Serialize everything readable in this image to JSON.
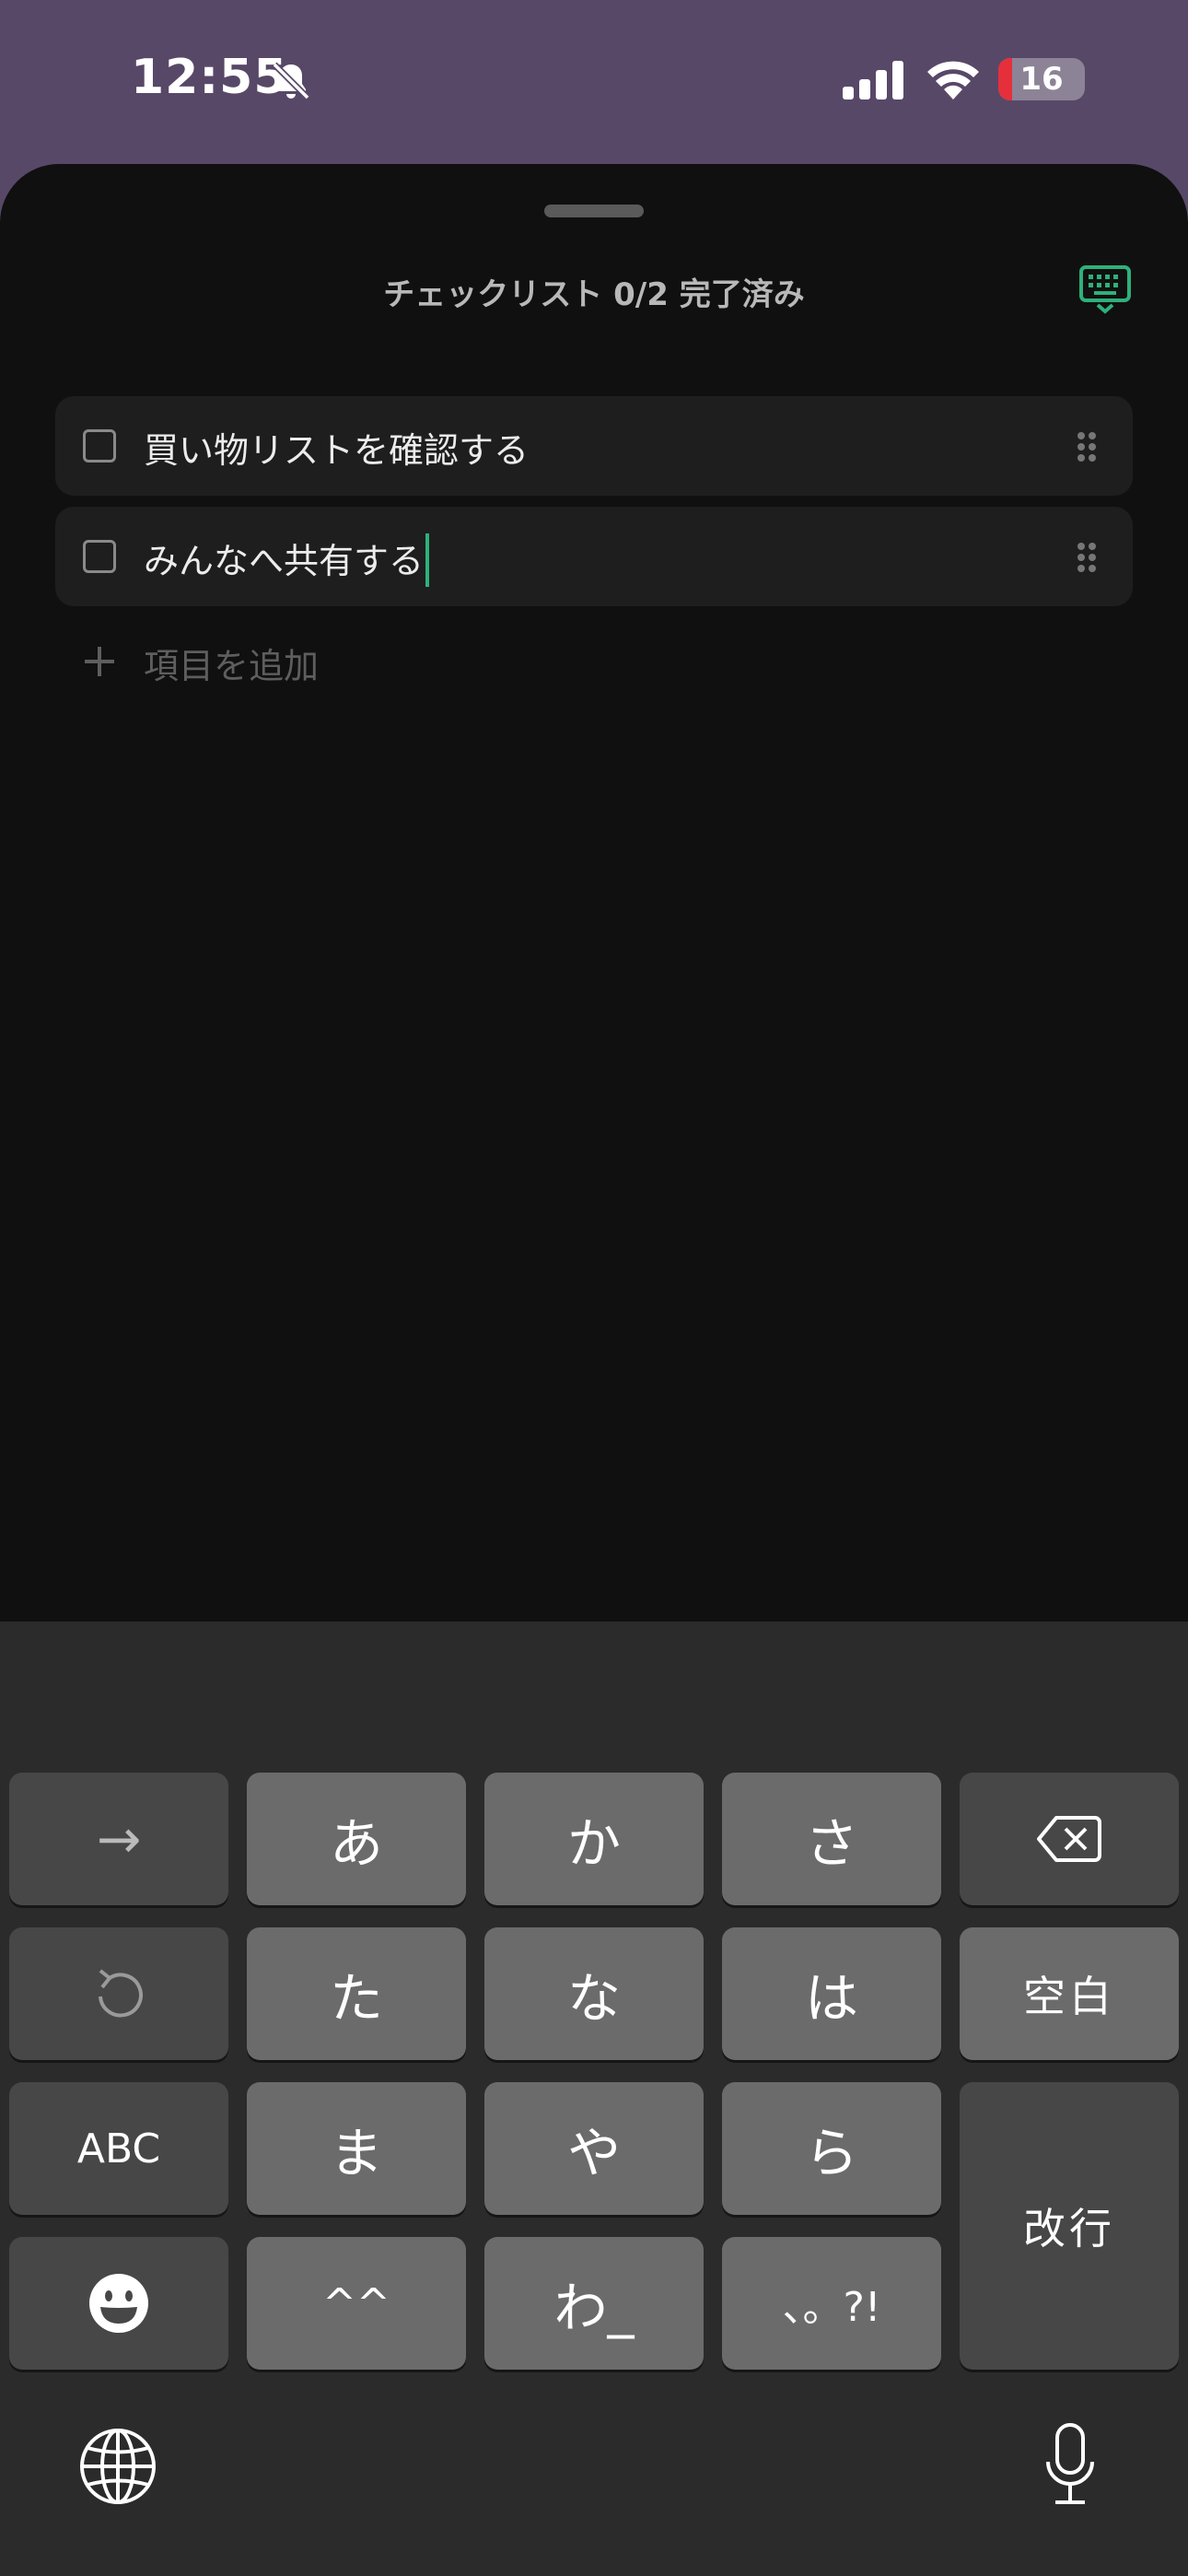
{
  "status_bar": {
    "time": "12:55",
    "battery_level": "16",
    "battery_fraction": 0.16,
    "icons": [
      "bell-slash-icon",
      "cellular-signal-icon",
      "wifi-icon",
      "battery-icon"
    ]
  },
  "sheet": {
    "title": "チェックリスト 0/2 完了済み",
    "dismiss_keyboard_icon": "keyboard-dismiss-icon",
    "accent_color": "#2fb07a"
  },
  "checklist": {
    "items": [
      {
        "label": "買い物リストを確認する",
        "checked": false
      },
      {
        "label": "みんなへ共有する",
        "checked": false
      }
    ],
    "add_label": "項目を追加"
  },
  "keyboard": {
    "row1": {
      "k1": "→",
      "k2": "あ",
      "k3": "か",
      "k4": "さ",
      "k5_icon": "backspace-icon"
    },
    "row2": {
      "k1_icon": "undo-icon",
      "k2": "た",
      "k3": "な",
      "k4": "は",
      "k5": "空白"
    },
    "row3": {
      "k1": "ABC",
      "k2": "ま",
      "k3": "や",
      "k4": "ら"
    },
    "row4": {
      "k1_icon": "emoji-icon",
      "k2": "^^",
      "k3": "わ_",
      "k4": "、。?!"
    },
    "return_label": "改行",
    "globe_icon": "globe-icon",
    "mic_icon": "microphone-icon"
  }
}
